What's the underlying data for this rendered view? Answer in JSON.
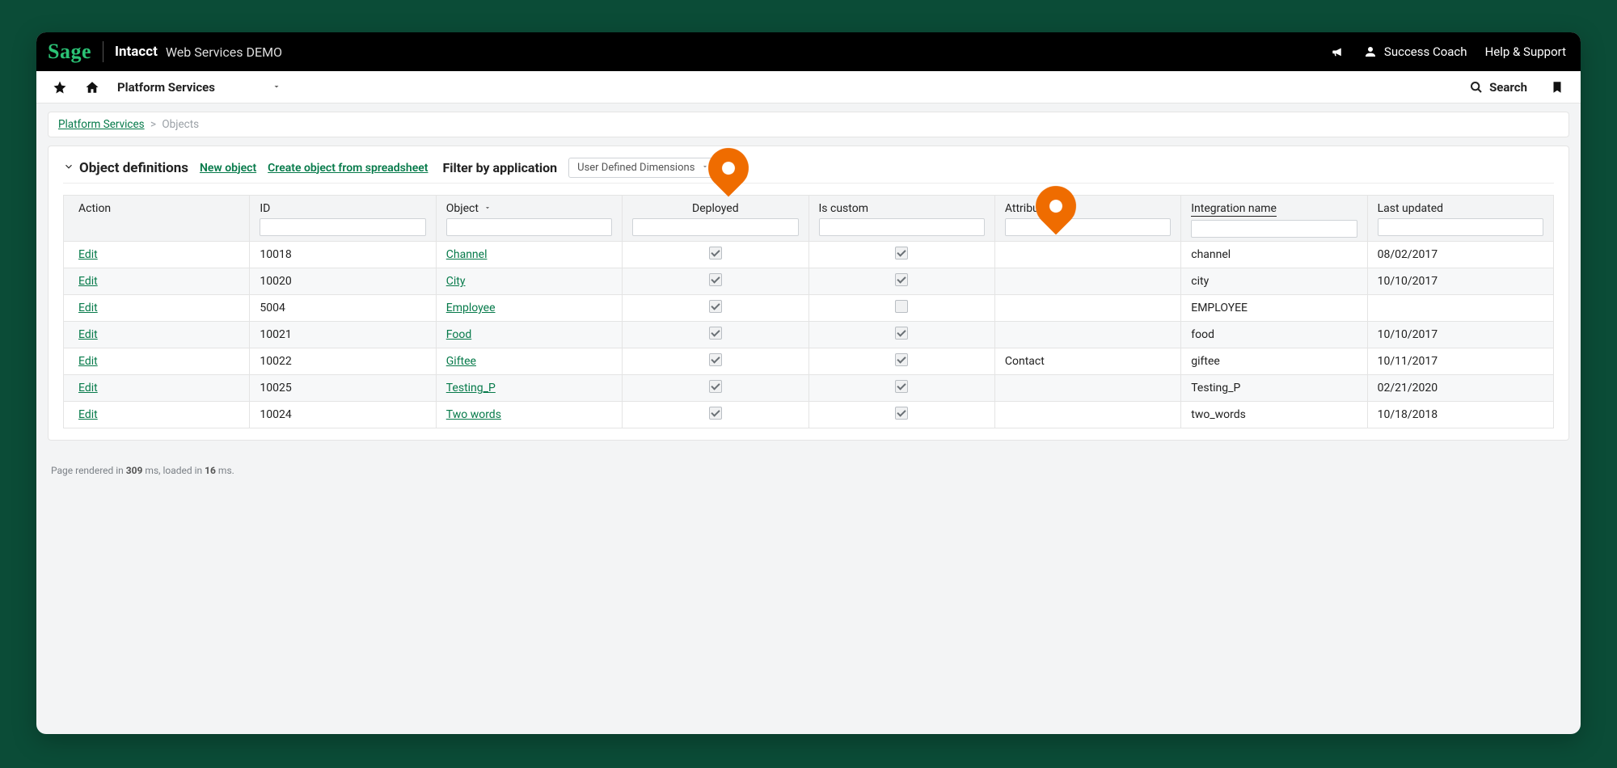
{
  "topbar": {
    "logo": "Sage",
    "app_name": "Intacct",
    "sub_name": "Web Services DEMO",
    "user_label": "Success Coach",
    "help_label": "Help & Support"
  },
  "navbar": {
    "dropdown_label": "Platform Services",
    "search_label": "Search"
  },
  "breadcrumb": {
    "link": "Platform Services",
    "current": "Objects"
  },
  "panel": {
    "section_title": "Object definitions",
    "new_object": "New object",
    "create_from_spreadsheet": "Create object from spreadsheet",
    "filter_label": "Filter by application",
    "filter_value": "User Defined Dimensions"
  },
  "columns": {
    "action": "Action",
    "id": "ID",
    "object": "Object",
    "deployed": "Deployed",
    "is_custom": "Is custom",
    "attributes": "Attributes",
    "integration": "Integration name",
    "last_updated": "Last updated"
  },
  "edit_label": "Edit",
  "rows": [
    {
      "id": "10018",
      "object": "Channel",
      "deployed": true,
      "is_custom": true,
      "attributes": "",
      "integration": "channel",
      "last_updated": "08/02/2017"
    },
    {
      "id": "10020",
      "object": "City",
      "deployed": true,
      "is_custom": true,
      "attributes": "",
      "integration": "city",
      "last_updated": "10/10/2017"
    },
    {
      "id": "5004",
      "object": "Employee",
      "deployed": true,
      "is_custom": false,
      "attributes": "",
      "integration": "EMPLOYEE",
      "last_updated": ""
    },
    {
      "id": "10021",
      "object": "Food",
      "deployed": true,
      "is_custom": true,
      "attributes": "",
      "integration": "food",
      "last_updated": "10/10/2017"
    },
    {
      "id": "10022",
      "object": "Giftee",
      "deployed": true,
      "is_custom": true,
      "attributes": "Contact",
      "integration": "giftee",
      "last_updated": "10/11/2017"
    },
    {
      "id": "10025",
      "object": "Testing_P",
      "deployed": true,
      "is_custom": true,
      "attributes": "",
      "integration": "Testing_P",
      "last_updated": "02/21/2020"
    },
    {
      "id": "10024",
      "object": "Two words",
      "deployed": true,
      "is_custom": true,
      "attributes": "",
      "integration": "two_words",
      "last_updated": "10/18/2018"
    }
  ],
  "footer": {
    "prefix": "Page rendered in ",
    "render_ms": "309",
    "mid": " ms, loaded in ",
    "load_ms": "16",
    "suffix": " ms."
  }
}
